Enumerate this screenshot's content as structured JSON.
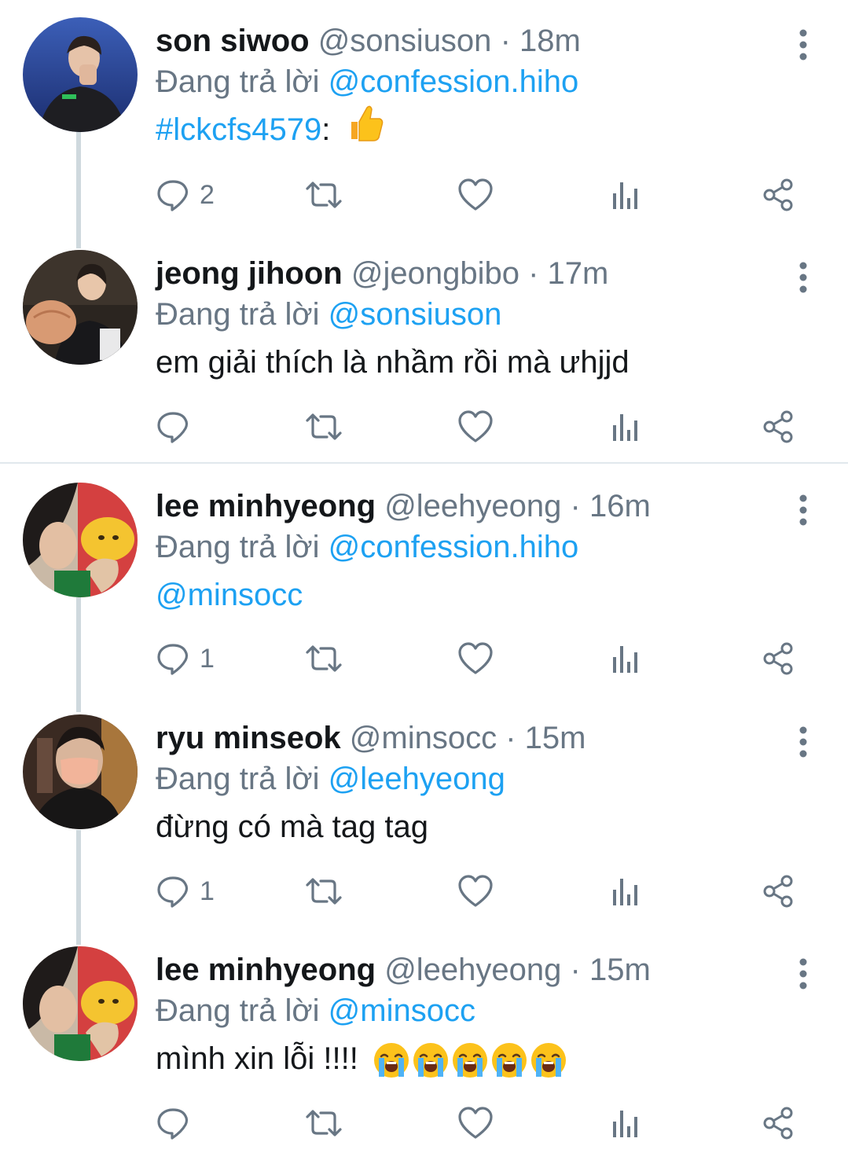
{
  "tweets": [
    {
      "name": "son siwoo",
      "handle": "@sonsiuson",
      "time": "· 18m",
      "reply_prefix": "Đang trả lời",
      "reply_to": "@confession.hiho",
      "body_link": "#lckcfs4579",
      "body_text": ":",
      "emoji": "thumbs-up",
      "reply_count": "2"
    },
    {
      "name": "jeong jihoon",
      "handle": "@jeongbibo",
      "time": "· 17m",
      "reply_prefix": "Đang trả lời",
      "reply_to": "@sonsiuson",
      "body_text": "em giải thích là nhầm rồi mà ưhjjd",
      "reply_count": ""
    },
    {
      "name": "lee minhyeong",
      "handle": "@leehyeong",
      "time": "· 16m",
      "reply_prefix": "Đang trả lời",
      "reply_to": "@confession.hiho",
      "body_link": "@minsocc",
      "reply_count": "1"
    },
    {
      "name": "ryu minseok",
      "handle": "@minsocc",
      "time": "· 15m",
      "reply_prefix": "Đang trả lời",
      "reply_to": "@leehyeong",
      "body_text": "đừng có mà tag tag",
      "reply_count": "1"
    },
    {
      "name": "lee minhyeong",
      "handle": "@leehyeong",
      "time": "· 15m",
      "reply_prefix": "Đang trả lời",
      "reply_to": "@minsocc",
      "body_text": "mình xin lỗi !!!!",
      "emoji": "loudly-crying-face",
      "emoji_repeat": 5,
      "reply_count": ""
    }
  ],
  "icons": {
    "reply": "reply-icon",
    "retweet": "retweet-icon",
    "like": "heart-icon",
    "analytics": "analytics-icon",
    "share": "share-icon",
    "more": "more-vertical-icon"
  },
  "colors": {
    "link": "#1da1f2",
    "secondary_text": "#687684",
    "primary_text": "#14171a",
    "thread_line": "#cfd9de",
    "divider": "#e1e8ed"
  }
}
